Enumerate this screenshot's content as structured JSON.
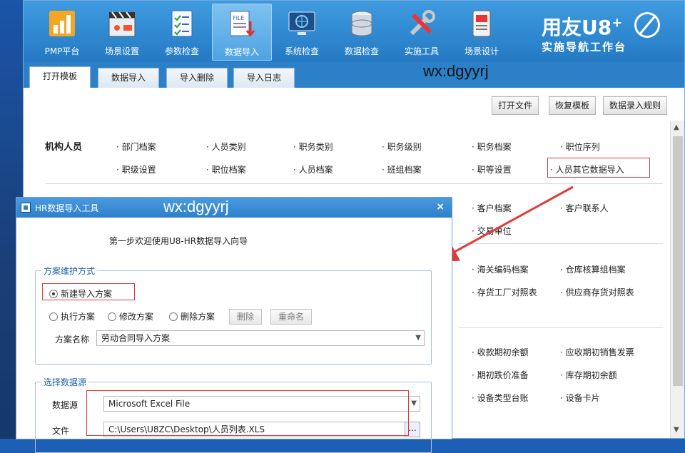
{
  "ribbon": {
    "items": [
      {
        "label": "PMP平台",
        "icon": "chart-icon",
        "active": false
      },
      {
        "label": "场景设置",
        "icon": "clapper-icon",
        "active": false
      },
      {
        "label": "参数检查",
        "icon": "checklist-icon",
        "active": false
      },
      {
        "label": "数据导入",
        "icon": "file-import-icon",
        "active": true
      },
      {
        "label": "系统检查",
        "icon": "monitor-icon",
        "active": false
      },
      {
        "label": "数据检查",
        "icon": "database-icon",
        "active": false
      },
      {
        "label": "实施工具",
        "icon": "tools-icon",
        "active": false
      },
      {
        "label": "场景设计",
        "icon": "pen-card-icon",
        "active": false
      }
    ],
    "logo_brand": "用友U8",
    "logo_plus": "+",
    "logo_sub": "实施导航工作台"
  },
  "tabs": [
    "打开模板",
    "数据导入",
    "导入删除",
    "导入日志"
  ],
  "watermark": "wx:dgyyrj",
  "toolbar": {
    "open_file": "打开文件",
    "restore_template": "恢复模板",
    "import_rules": "数据录入规则"
  },
  "content": {
    "section1_title": "机构人员",
    "row1": [
      "· 部门档案",
      "· 人员类别",
      "· 职务类别",
      "· 职务级别",
      "· 职务档案",
      "· 职位序列"
    ],
    "row2": [
      "· 职级设置",
      "· 职位档案",
      "· 人员档案",
      "· 班组档案",
      "· 职等设置",
      "· 人员其它数据导入"
    ],
    "row3": [
      "· 客户档案",
      "· 客户联系人"
    ],
    "row4": [
      "· 交易单位"
    ],
    "row5": [
      "· 海关编码档案",
      "· 仓库核算组档案"
    ],
    "row6": [
      "· 存货工厂对照表",
      "· 供应商存货对照表"
    ],
    "row7": [
      "· 收款期初余额",
      "· 应收期初销售发票"
    ],
    "row8": [
      "· 期初跌价准备",
      "· 库存期初余额"
    ],
    "row9": [
      "· 设备类型台账",
      "· 设备卡片"
    ]
  },
  "dialog": {
    "title": "HR数据导入工具",
    "watermark": "wx:dgyyrj",
    "step": "第一步欢迎使用U8-HR数据导入向导",
    "group1": "方案维护方式",
    "radio_new": "新建导入方案",
    "radio_exec": "执行方案",
    "radio_edit": "修改方案",
    "radio_del": "删除方案",
    "btn_delete": "删除",
    "btn_rename": "重命名",
    "scheme_label": "方案名称",
    "scheme_value": "劳动合同导入方案",
    "group2": "选择数据源",
    "source_label": "数据源",
    "source_value": "Microsoft Excel File",
    "file_label": "文件",
    "file_value": "C:\\Users\\U8ZC\\Desktop\\人员列表.XLS",
    "browse": "..."
  },
  "colors": {
    "ribbon": "#2c84cc",
    "highlight": "#e23a3a",
    "legend": "#1f5fa8"
  }
}
